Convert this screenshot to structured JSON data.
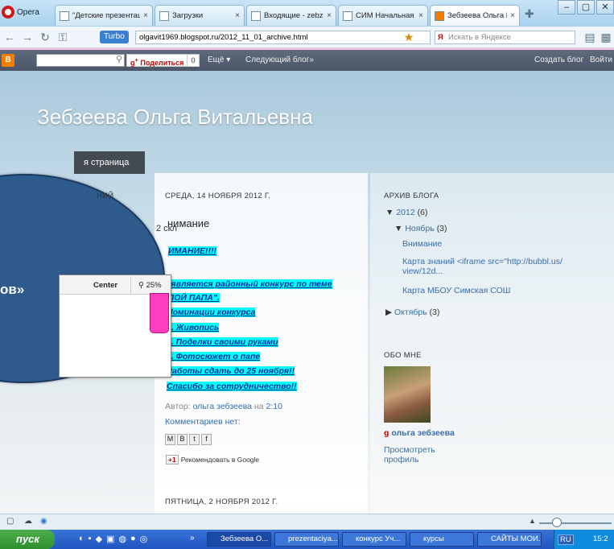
{
  "browser": {
    "opera_label": "Opera",
    "tabs": [
      {
        "title": "\"Детские презентац...",
        "x": "×"
      },
      {
        "title": "Загрузки",
        "x": "×"
      },
      {
        "title": "Входящие - zebzeev...",
        "x": "×"
      },
      {
        "title": "СИМ Начальная школа",
        "x": "×"
      },
      {
        "title": "Зебзеева Ольга Вит...",
        "x": "×"
      }
    ],
    "turbo": "Turbo",
    "url": "olgavit1969.blogspot.ru/2012_11_01_archive.html",
    "search_placeholder": "Искать в Яндексе"
  },
  "navbar": {
    "share": "Поделиться",
    "count": "0",
    "more": "Ещё ▾",
    "next": "Следующий блог»",
    "create": "Создать блог",
    "login": "Войти"
  },
  "blog": {
    "title": "Зебзеева Ольга Витальевна",
    "home_tab": "я страница",
    "left_heading": "НИЙ",
    "date1": "СРЕДА, 14 НОЯБРЯ 2012 Г.",
    "post_title": "нимание",
    "pink_label": "2 скл",
    "body": [
      "ИМАНИЕ!!!!",
      "ъявляется районный конкурс по теме",
      "ЛОЙ ПАПА\".",
      "Номинации конкурса",
      "1. Живопись",
      "2. Поделки своими руками",
      "3. Фотосюжет о папе",
      " Работы сдать до 25 ноября!!",
      "Спасибо за сотрудничество!!"
    ],
    "author_prefix": "Автор:",
    "author": "ольга зебзеева",
    "on": "на",
    "time": "2:10",
    "comments": "Комментариев нет:",
    "plus1": "+1",
    "recommend": "Рекомендовать в Google",
    "date2": "ПЯТНИЦА, 2 НОЯБРЯ 2012 Г.",
    "left_fragment": "ов»"
  },
  "sidebar": {
    "archive_heading": "АРХИВ БЛОГА",
    "year": "2012",
    "year_count": "(6)",
    "month": "Ноябрь",
    "month_count": "(3)",
    "posts": [
      "Внимание",
      "Карта знаний <iframe src=\"http://bubbl.us/ view/12d...",
      "Карта МБОУ Симская СОШ"
    ],
    "oct": "Октябрь",
    "oct_count": "(3)",
    "about_heading": "ОБО МНЕ",
    "name": "ольга зебзеева",
    "profile": "Просмотреть профиль"
  },
  "overlay": {
    "center": "Center",
    "zoom": "25%"
  },
  "taskbar": {
    "start": "пуск",
    "items": [
      "Зебзеева О...",
      "prezentaciya...",
      "конкурс Уч...",
      "курсы",
      "САЙТЫ МОИ..."
    ],
    "lang": "RU",
    "clock": "15:2"
  },
  "colors": {
    "accent": "#3a6da8",
    "highlight": "#00ffff",
    "pink": "#f6c3dc"
  }
}
